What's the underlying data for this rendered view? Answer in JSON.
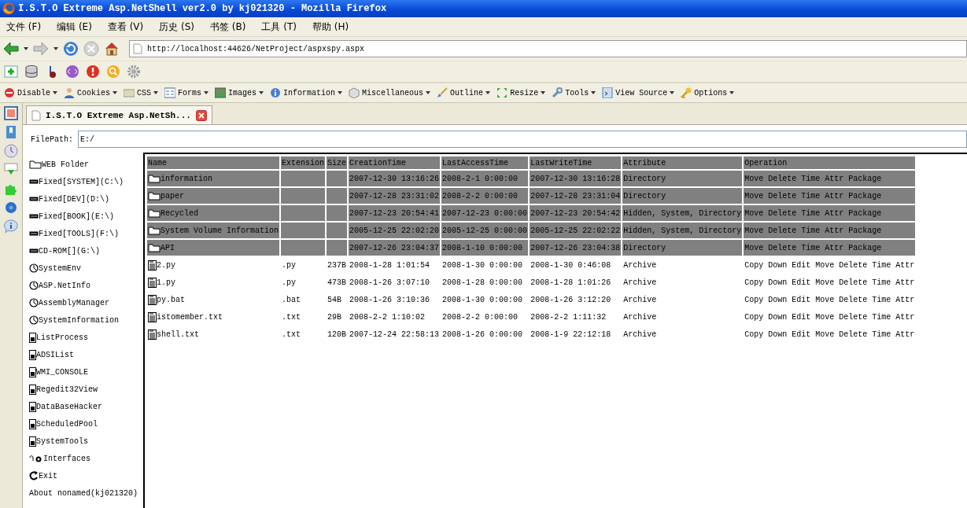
{
  "window": {
    "title": "I.S.T.O Extreme Asp.NetShell ver2.0 by kj021320 - Mozilla Firefox"
  },
  "menu_bar": [
    "文件 (F)",
    "编辑 (E)",
    "查看 (V)",
    "历史 (S)",
    "书签 (B)",
    "工具 (T)",
    "帮助 (H)"
  ],
  "address_bar": {
    "url": "http://localhost:44626/NetProject/aspxspy.aspx"
  },
  "developer_toolbar": [
    "Disable",
    "Cookies",
    "CSS",
    "Forms",
    "Images",
    "Information",
    "Miscellaneous",
    "Outline",
    "Resize",
    "Tools",
    "View Source",
    "Options"
  ],
  "tabs": [
    {
      "label": "I.S.T.O Extreme Asp.NetSh...",
      "selected": true
    }
  ],
  "file_path": {
    "label": "FilePath:",
    "value": "E:/"
  },
  "sidebar": {
    "items": [
      {
        "kind": "folder",
        "label": "WEB Folder"
      },
      {
        "kind": "drive",
        "label": "Fixed[SYSTEM](C:\\)"
      },
      {
        "kind": "drive",
        "label": "Fixed[DEV](D:\\)"
      },
      {
        "kind": "drive",
        "label": "Fixed[BOOK](E:\\)"
      },
      {
        "kind": "drive",
        "label": "Fixed[TOOLS](F:\\)"
      },
      {
        "kind": "drive",
        "label": "CD-ROM[](G:\\)"
      },
      {
        "kind": "gauge",
        "label": "SystemEnv"
      },
      {
        "kind": "gauge",
        "label": "ASP.NetInfo"
      },
      {
        "kind": "gauge",
        "label": "AssemblyManager"
      },
      {
        "kind": "gauge",
        "label": "SystemInformation"
      },
      {
        "kind": "tool",
        "label": "ListProcess"
      },
      {
        "kind": "tool",
        "label": "ADSIList"
      },
      {
        "kind": "tool",
        "label": "WMI_CONSOLE"
      },
      {
        "kind": "tool",
        "label": "Regedit32View"
      },
      {
        "kind": "tool",
        "label": "DataBaseHacker"
      },
      {
        "kind": "tool",
        "label": "ScheduledPool"
      },
      {
        "kind": "tool",
        "label": "SystemTools"
      },
      {
        "kind": "interface",
        "label": "Interfaces"
      },
      {
        "kind": "exit",
        "label": "Exit"
      },
      {
        "kind": "text",
        "label": "About nonamed(kj021320)"
      }
    ]
  },
  "table": {
    "columns": [
      "Name",
      "Extension",
      "Size",
      "CreationTime",
      "LastAccessTime",
      "LastWriteTime",
      "Attribute",
      "Operation"
    ],
    "rows": [
      {
        "kind": "directory",
        "name": "information",
        "extension": "",
        "size": "",
        "created": "2007-12-30 13:16:26",
        "accessed": "2008-2-1 0:00:00",
        "written": "2007-12-30 13:16:28",
        "attribute": "Directory",
        "operations": [
          "Move",
          "Delete",
          "Time",
          "Attr",
          "Package"
        ]
      },
      {
        "kind": "directory",
        "name": "paper",
        "extension": "",
        "size": "",
        "created": "2007-12-28 23:31:02",
        "accessed": "2008-2-2 0:00:00",
        "written": "2007-12-28 23:31:04",
        "attribute": "Directory",
        "operations": [
          "Move",
          "Delete",
          "Time",
          "Attr",
          "Package"
        ]
      },
      {
        "kind": "directory",
        "name": "Recycled",
        "extension": "",
        "size": "",
        "created": "2007-12-23 20:54:41",
        "accessed": "2007-12-23 0:00:00",
        "written": "2007-12-23 20:54:42",
        "attribute": "Hidden, System, Directory",
        "operations": [
          "Move",
          "Delete",
          "Time",
          "Attr",
          "Package"
        ]
      },
      {
        "kind": "directory",
        "name": "System Volume Information",
        "extension": "",
        "size": "",
        "created": "2005-12-25 22:02:20",
        "accessed": "2005-12-25 0:00:00",
        "written": "2005-12-25 22:02:22",
        "attribute": "Hidden, System, Directory",
        "operations": [
          "Move",
          "Delete",
          "Time",
          "Attr",
          "Package"
        ]
      },
      {
        "kind": "directory",
        "name": "API",
        "extension": "",
        "size": "",
        "created": "2007-12-26 23:04:37",
        "accessed": "2008-1-10 0:00:00",
        "written": "2007-12-26 23:04:38",
        "attribute": "Directory",
        "operations": [
          "Move",
          "Delete",
          "Time",
          "Attr",
          "Package"
        ]
      },
      {
        "kind": "file",
        "name": "2.py",
        "extension": ".py",
        "size": "237B",
        "created": "2008-1-28 1:01:54",
        "accessed": "2008-1-30 0:00:00",
        "written": "2008-1-30 0:46:08",
        "attribute": "Archive",
        "operations": [
          "Copy",
          "Down",
          "Edit",
          "Move",
          "Delete",
          "Time",
          "Attr"
        ]
      },
      {
        "kind": "file",
        "name": "1.py",
        "extension": ".py",
        "size": "473B",
        "created": "2008-1-26 3:07:10",
        "accessed": "2008-1-28 0:00:00",
        "written": "2008-1-28 1:01:26",
        "attribute": "Archive",
        "operations": [
          "Copy",
          "Down",
          "Edit",
          "Move",
          "Delete",
          "Time",
          "Attr"
        ]
      },
      {
        "kind": "file",
        "name": "py.bat",
        "extension": ".bat",
        "size": "54B",
        "created": "2008-1-26 3:10:36",
        "accessed": "2008-1-30 0:00:00",
        "written": "2008-1-26 3:12:20",
        "attribute": "Archive",
        "operations": [
          "Copy",
          "Down",
          "Edit",
          "Move",
          "Delete",
          "Time",
          "Attr"
        ]
      },
      {
        "kind": "file",
        "name": "istomember.txt",
        "extension": ".txt",
        "size": "29B",
        "created": "2008-2-2 1:10:02",
        "accessed": "2008-2-2 0:00:00",
        "written": "2008-2-2 1:11:32",
        "attribute": "Archive",
        "operations": [
          "Copy",
          "Down",
          "Edit",
          "Move",
          "Delete",
          "Time",
          "Attr"
        ]
      },
      {
        "kind": "file",
        "name": "shell.txt",
        "extension": ".txt",
        "size": "120B",
        "created": "2007-12-24 22:58:13",
        "accessed": "2008-1-26 0:00:00",
        "written": "2008-1-9 22:12:18",
        "attribute": "Archive",
        "operations": [
          "Copy",
          "Down",
          "Edit",
          "Move",
          "Delete",
          "Time",
          "Attr"
        ]
      }
    ]
  }
}
